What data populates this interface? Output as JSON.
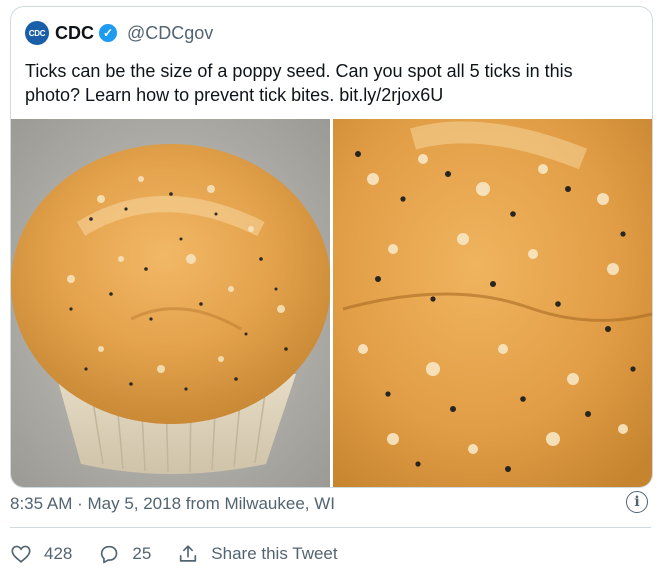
{
  "author": {
    "logo_text": "CDC",
    "name": "CDC",
    "handle": "@CDCgov"
  },
  "tweet": {
    "text_line1": "Ticks can be the size of a poppy seed. Can you spot all 5 ticks in this",
    "text_line2": "photo? Learn how to prevent tick bites. bit.ly/2rjox6U"
  },
  "meta": {
    "timestamp": "8:35 AM · May 5, 2018 from Milwaukee, WI",
    "info_symbol": "i"
  },
  "actions": {
    "likes": "428",
    "replies": "25",
    "share_label": "Share this Tweet"
  },
  "icons": {
    "verified": "verified-badge-icon",
    "info": "info-icon",
    "like": "heart-icon",
    "reply": "reply-bubble-icon",
    "share": "share-icon"
  },
  "colors": {
    "verified": "#1d9bf0",
    "logo": "#1b5ea8",
    "muted": "#536471",
    "border": "#cfd9de"
  }
}
